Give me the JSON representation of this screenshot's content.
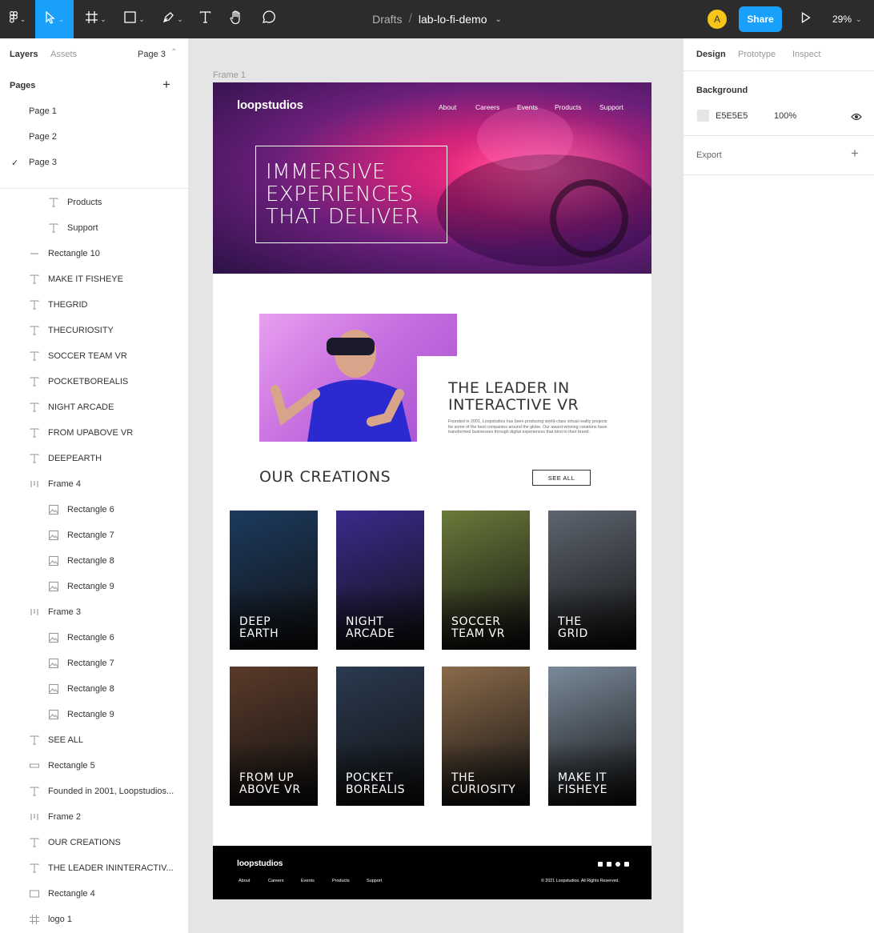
{
  "toolbar": {
    "breadcrumb_root": "Drafts",
    "separator": "/",
    "file_name": "lab-lo-fi-demo",
    "avatar_initial": "A",
    "share_label": "Share",
    "zoom": "29%",
    "accent_color": "#18a0fb"
  },
  "left_panel": {
    "tabs": {
      "layers": "Layers",
      "assets": "Assets",
      "current_page": "Page 3"
    },
    "pages_title": "Pages",
    "pages": [
      "Page 1",
      "Page 2",
      "Page 3"
    ],
    "layers": [
      {
        "icon": "text-icon",
        "name": "Products"
      },
      {
        "icon": "text-icon",
        "name": "Support"
      },
      {
        "icon": "line-icon",
        "name": "Rectangle 10"
      },
      {
        "icon": "text-icon",
        "name": "MAKE IT FISHEYE"
      },
      {
        "icon": "text-icon",
        "name": "THEGRID"
      },
      {
        "icon": "text-icon",
        "name": "THECURIOSITY"
      },
      {
        "icon": "text-icon",
        "name": "SOCCER TEAM VR"
      },
      {
        "icon": "text-icon",
        "name": "POCKETBOREALIS"
      },
      {
        "icon": "text-icon",
        "name": "NIGHT ARCADE"
      },
      {
        "icon": "text-icon",
        "name": "FROM UPABOVE VR"
      },
      {
        "icon": "text-icon",
        "name": "DEEPEARTH"
      },
      {
        "icon": "autolayout-icon",
        "name": "Frame 4"
      },
      {
        "icon": "image-icon",
        "name": "Rectangle 6"
      },
      {
        "icon": "image-icon",
        "name": "Rectangle 7"
      },
      {
        "icon": "image-icon",
        "name": "Rectangle 8"
      },
      {
        "icon": "image-icon",
        "name": "Rectangle 9"
      },
      {
        "icon": "autolayout-icon",
        "name": "Frame 3"
      },
      {
        "icon": "image-icon",
        "name": "Rectangle 6"
      },
      {
        "icon": "image-icon",
        "name": "Rectangle 7"
      },
      {
        "icon": "image-icon",
        "name": "Rectangle 8"
      },
      {
        "icon": "image-icon",
        "name": "Rectangle 9"
      },
      {
        "icon": "text-icon",
        "name": "SEE ALL"
      },
      {
        "icon": "rectangle-thin-icon",
        "name": "Rectangle 5"
      },
      {
        "icon": "text-icon",
        "name": "Founded in 2001, Loopstudios..."
      },
      {
        "icon": "autolayout-icon",
        "name": "Frame 2"
      },
      {
        "icon": "text-icon",
        "name": "OUR CREATIONS"
      },
      {
        "icon": "text-icon",
        "name": "THE LEADER ININTERACTIV..."
      },
      {
        "icon": "rectangle-icon",
        "name": "Rectangle 4"
      },
      {
        "icon": "frame-icon",
        "name": "logo 1"
      }
    ]
  },
  "right_panel": {
    "tabs": [
      "Design",
      "Prototype",
      "Inspect"
    ],
    "background_title": "Background",
    "background_hex": "E5E5E5",
    "background_opacity": "100%",
    "export_title": "Export"
  },
  "canvas": {
    "frame_label": "Frame 1",
    "logo": "loopstudios",
    "nav": [
      "About",
      "Careers",
      "Events",
      "Products",
      "Support"
    ],
    "hero_title": "IMMERSIVE EXPERIENCES THAT DELIVER",
    "leader_title": "THE LEADER IN INTERACTIVE VR",
    "leader_body": "Founded in 2001, Loopstudios has been producing world-class virtual reality projects for some of the best companies around the globe. Our award-winning creations have transformed businesses through digital experiences that bind to their brand.",
    "creations_title": "OUR CREATIONS",
    "see_all": "SEE ALL",
    "cards": [
      {
        "label": "DEEP\nEARTH",
        "color": "#1c3a5e"
      },
      {
        "label": "NIGHT\nARCADE",
        "color": "#3b2a8c"
      },
      {
        "label": "SOCCER\nTEAM VR",
        "color": "#6a7a3a"
      },
      {
        "label": "THE\nGRID",
        "color": "#5e6570"
      },
      {
        "label": "FROM UP\nABOVE VR",
        "color": "#5a3a2a"
      },
      {
        "label": "POCKET\nBOREALIS",
        "color": "#2a3a50"
      },
      {
        "label": "THE\nCURIOSITY",
        "color": "#8a6a4a"
      },
      {
        "label": "MAKE IT\nFISHEYE",
        "color": "#7a8a9a"
      }
    ],
    "footer_logo": "loopstudios",
    "footer_nav": [
      "About",
      "Careers",
      "Events",
      "Products",
      "Support"
    ],
    "copyright": "© 2021 Loopstudios. All Rights Reserved."
  }
}
